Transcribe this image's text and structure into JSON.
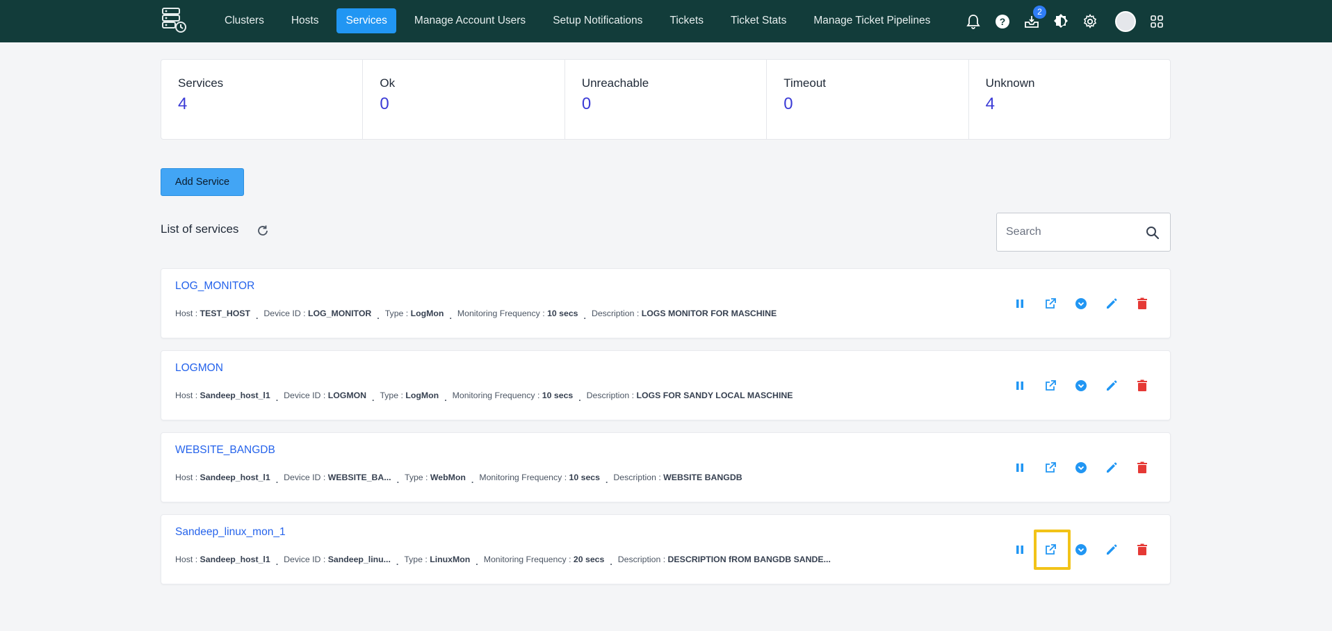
{
  "nav": {
    "items": [
      {
        "label": "Clusters",
        "active": false
      },
      {
        "label": "Hosts",
        "active": false
      },
      {
        "label": "Services",
        "active": true
      },
      {
        "label": "Manage Account Users",
        "active": false
      },
      {
        "label": "Setup Notifications",
        "active": false
      },
      {
        "label": "Tickets",
        "active": false
      },
      {
        "label": "Ticket Stats",
        "active": false
      },
      {
        "label": "Manage Ticket Pipelines",
        "active": false
      }
    ],
    "inbox_badge": "2"
  },
  "stats": [
    {
      "label": "Services",
      "value": "4"
    },
    {
      "label": "Ok",
      "value": "0"
    },
    {
      "label": "Unreachable",
      "value": "0"
    },
    {
      "label": "Timeout",
      "value": "0"
    },
    {
      "label": "Unknown",
      "value": "4"
    }
  ],
  "add_button_label": "Add Service",
  "list_title": "List of services",
  "search": {
    "placeholder": "Search"
  },
  "meta_labels": {
    "host": "Host : ",
    "device": "Device ID : ",
    "type": "Type : ",
    "freq": "Monitoring Frequency : ",
    "desc": "Description : ",
    "separator": "."
  },
  "services": [
    {
      "name": "LOG_MONITOR",
      "host": "TEST_HOST",
      "device_id": "LOG_MONITOR",
      "type": "LogMon",
      "frequency": "10 secs",
      "description": "LOGS MONITOR FOR MASCHINE"
    },
    {
      "name": "LOGMON",
      "host": "Sandeep_host_l1",
      "device_id": "LOGMON",
      "type": "LogMon",
      "frequency": "10 secs",
      "description": "LOGS FOR SANDY LOCAL MASCHINE"
    },
    {
      "name": "WEBSITE_BANGDB",
      "host": "Sandeep_host_l1",
      "device_id": "WEBSITE_BA...",
      "type": "WebMon",
      "frequency": "10 secs",
      "description": "WEBSITE BANGDB"
    },
    {
      "name": "Sandeep_linux_mon_1",
      "host": "Sandeep_host_l1",
      "device_id": "Sandeep_linu...",
      "type": "LinuxMon",
      "frequency": "20 secs",
      "description": "DESCRIPTION fROM BANGDB SANDE..."
    }
  ],
  "colors": {
    "topbar": "#123c3a",
    "accent": "#2196f3",
    "stat_value": "#3b3bd6",
    "link": "#2563eb",
    "action_blue": "#2196f3",
    "delete_red": "#e53935",
    "highlight": "#f2c318"
  }
}
